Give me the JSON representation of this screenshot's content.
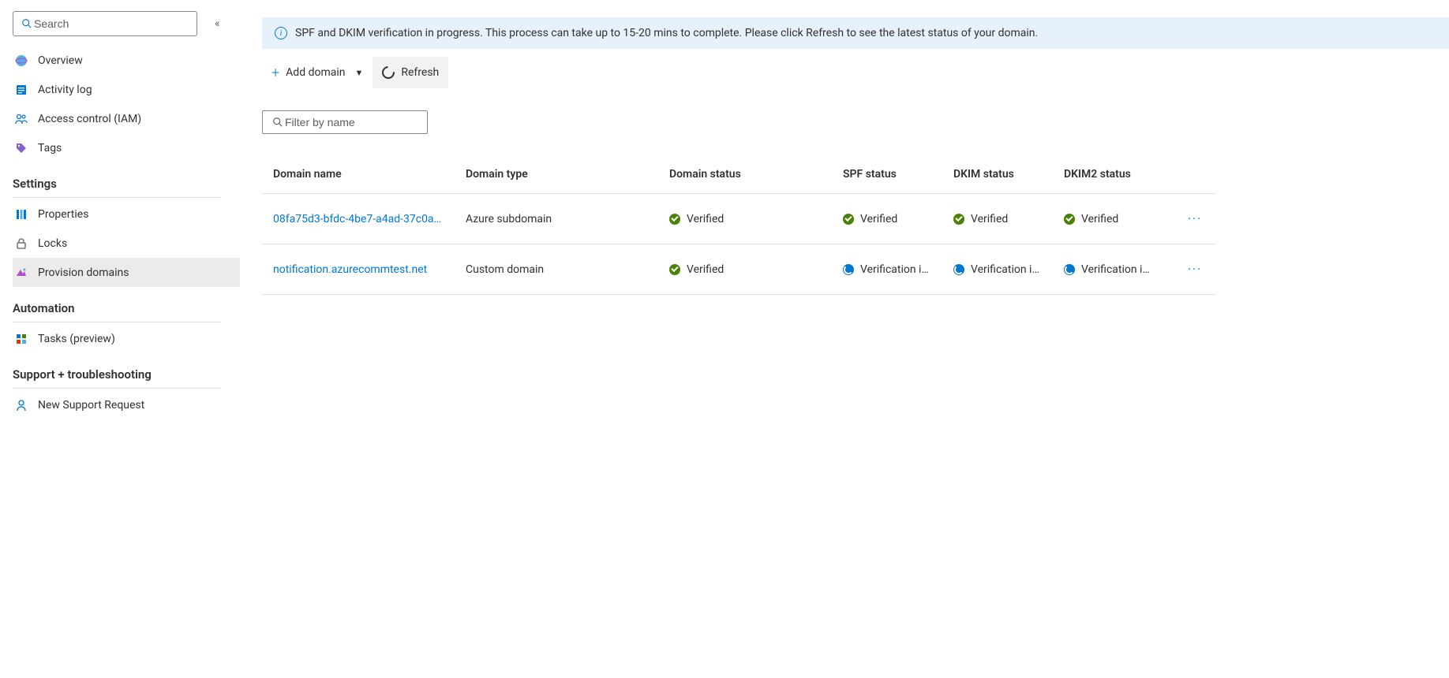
{
  "sidebar": {
    "search_placeholder": "Search",
    "items_top": [
      {
        "label": "Overview"
      },
      {
        "label": "Activity log"
      },
      {
        "label": "Access control (IAM)"
      },
      {
        "label": "Tags"
      }
    ],
    "section_settings": "Settings",
    "items_settings": [
      {
        "label": "Properties"
      },
      {
        "label": "Locks"
      },
      {
        "label": "Provision domains"
      }
    ],
    "section_automation": "Automation",
    "items_automation": [
      {
        "label": "Tasks (preview)"
      }
    ],
    "section_support": "Support + troubleshooting",
    "items_support": [
      {
        "label": "New Support Request"
      }
    ]
  },
  "banner": {
    "text": "SPF and DKIM verification in progress. This process can take up to 15-20 mins to complete. Please click Refresh to see the latest status of your domain."
  },
  "toolbar": {
    "add_domain": "Add domain",
    "refresh": "Refresh"
  },
  "filter": {
    "placeholder": "Filter by name"
  },
  "table": {
    "headers": {
      "domain_name": "Domain name",
      "domain_type": "Domain type",
      "domain_status": "Domain status",
      "spf_status": "SPF status",
      "dkim_status": "DKIM status",
      "dkim2_status": "DKIM2 status"
    },
    "rows": [
      {
        "domain_name": "08fa75d3-bfdc-4be7-a4ad-37c0a…",
        "domain_type": "Azure subdomain",
        "domain_status": {
          "icon": "check",
          "text": "Verified"
        },
        "spf_status": {
          "icon": "check",
          "text": "Verified"
        },
        "dkim_status": {
          "icon": "check",
          "text": "Verified"
        },
        "dkim2_status": {
          "icon": "check",
          "text": "Verified"
        }
      },
      {
        "domain_name": "notification.azurecommtest.net",
        "domain_type": "Custom domain",
        "domain_status": {
          "icon": "check",
          "text": "Verified"
        },
        "spf_status": {
          "icon": "progress",
          "text": "Verification i…"
        },
        "dkim_status": {
          "icon": "progress",
          "text": "Verification i…"
        },
        "dkim2_status": {
          "icon": "progress",
          "text": "Verification i…"
        }
      }
    ]
  }
}
